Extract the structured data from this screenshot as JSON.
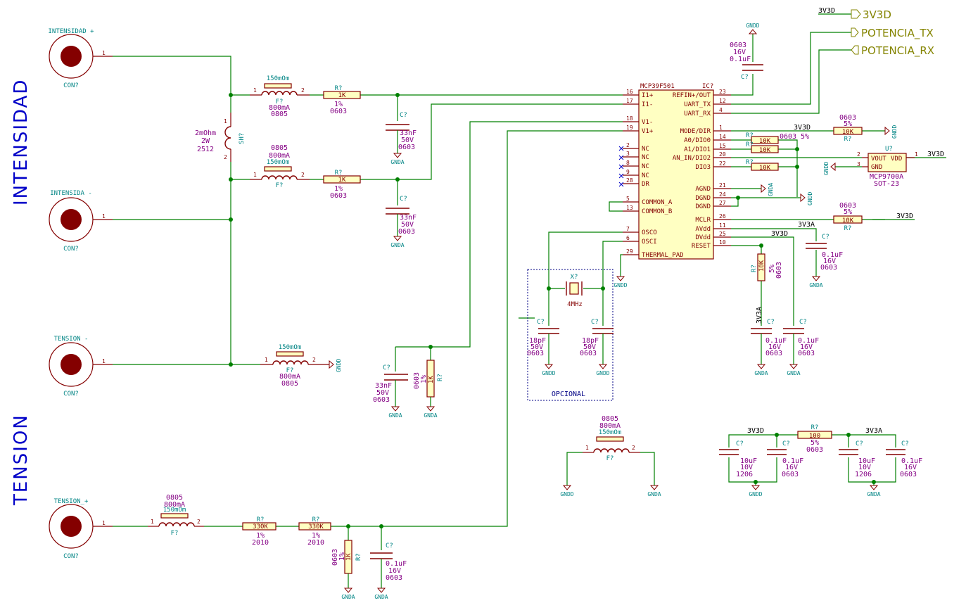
{
  "sections": {
    "intensidad": "INTENSIDAD",
    "tension": "TENSION"
  },
  "global_labels": {
    "v3v3d": "3V3D",
    "tx": "POTENCIA_TX",
    "rx": "POTENCIA_RX"
  },
  "connectors": [
    {
      "title": "INTENSIDAD +",
      "ref": "CON?",
      "pin": "1"
    },
    {
      "title": "INTENSIDA -",
      "ref": "CON?",
      "pin": "1"
    },
    {
      "title": "TENSION -",
      "ref": "CON?",
      "pin": "1"
    },
    {
      "title": "TENSION_+",
      "ref": "CON?",
      "pin": "1"
    }
  ],
  "ferrite": {
    "ref": "F?",
    "label": "150mOm",
    "current": "800mA",
    "package": "0805"
  },
  "shunt": {
    "ref": "SH?",
    "value": "2mOhm",
    "power": "2W",
    "package": "2512"
  },
  "ic": {
    "ref": "IC?",
    "name": "MCP39F501",
    "left_pins": [
      {
        "num": "16",
        "name": "I1+"
      },
      {
        "num": "17",
        "name": "I1-"
      },
      {
        "num": "18",
        "name": "V1-"
      },
      {
        "num": "19",
        "name": "V1+"
      },
      {
        "num": "2",
        "name": "NC"
      },
      {
        "num": "3",
        "name": "NC"
      },
      {
        "num": "8",
        "name": "NC"
      },
      {
        "num": "9",
        "name": "NC"
      },
      {
        "num": "28",
        "name": "DR"
      },
      {
        "num": "5",
        "name": "COMMON_A"
      },
      {
        "num": "13",
        "name": "COMMON_B"
      },
      {
        "num": "7",
        "name": "OSCO"
      },
      {
        "num": "6",
        "name": "OSCI"
      },
      {
        "num": "29",
        "name": "THERMAL_PAD"
      }
    ],
    "right_pins": [
      {
        "num": "23",
        "name": "REFIN+/OUT"
      },
      {
        "num": "12",
        "name": "UART_TX"
      },
      {
        "num": "4",
        "name": "UART_RX"
      },
      {
        "num": "1",
        "name": "MODE/DIR"
      },
      {
        "num": "14",
        "name": "A0/DIO0"
      },
      {
        "num": "15",
        "name": "A1/DIO1"
      },
      {
        "num": "20",
        "name": "AN_IN/DIO2"
      },
      {
        "num": "22",
        "name": "DIO3"
      },
      {
        "num": "21",
        "name": "AGND"
      },
      {
        "num": "24",
        "name": "DGND"
      },
      {
        "num": "27",
        "name": "DGND"
      },
      {
        "num": "26",
        "name": "MCLR"
      },
      {
        "num": "11",
        "name": "AVdd"
      },
      {
        "num": "25",
        "name": "DVdd"
      },
      {
        "num": "10",
        "name": "RESET"
      }
    ]
  },
  "temp_sensor": {
    "ref": "U?",
    "name": "MCP9700A",
    "package": "SOT-23",
    "pins": [
      "VOUT",
      "VDD",
      "GND"
    ],
    "pin_numbers": [
      "2",
      "1",
      "3"
    ]
  },
  "crystal": {
    "ref": "X?",
    "value": "4MHz"
  },
  "opcional": "OPCIONAL",
  "resistors": {
    "r_1k_top": {
      "ref": "R?",
      "value": "1K",
      "tol": "1%",
      "pkg": "0603"
    },
    "r_1k_bot": {
      "ref": "R?",
      "value": "1K",
      "tol": "1%",
      "pkg": "0603"
    },
    "r_v_div": {
      "ref": "R?",
      "value": "1K",
      "tol": "1%",
      "pkg": "0603"
    },
    "r_mode": {
      "ref": "R?",
      "value": "10K",
      "tol": "5%",
      "pkg": "0603"
    },
    "r_a0": {
      "ref": "R?",
      "value": "10K",
      "tol": "5%",
      "pkg": "0603"
    },
    "r_a1": {
      "ref": "R?",
      "value": "10K"
    },
    "r_dio3": {
      "ref": "R?",
      "value": "10K"
    },
    "r_mclr": {
      "ref": "R?",
      "value": "10K",
      "tol": "5%",
      "pkg": "0603"
    },
    "r_reset": {
      "ref": "R?",
      "value": "10K",
      "tol": "5%",
      "pkg": "0603"
    },
    "r_330a": {
      "ref": "R?",
      "value": "330K",
      "tol": "1%",
      "pkg": "2010"
    },
    "r_330b": {
      "ref": "R?",
      "value": "330K",
      "tol": "1%",
      "pkg": "2010"
    },
    "r_tension": {
      "ref": "R?",
      "value": "1K",
      "tol": "1%",
      "pkg": "0603"
    },
    "r_100": {
      "ref": "R?",
      "value": "100",
      "tol": "5%",
      "pkg": "0603"
    }
  },
  "capacitors": {
    "c33_a": {
      "ref": "C?",
      "value": "33nF",
      "volt": "50V",
      "pkg": "0603"
    },
    "c33_b": {
      "ref": "C?",
      "value": "33nF",
      "volt": "50V",
      "pkg": "0603"
    },
    "c33_c": {
      "ref": "C?",
      "value": "33nF",
      "volt": "50V",
      "pkg": "0603"
    },
    "c_ref": {
      "ref": "C?",
      "value": "0.1uF",
      "volt": "16V",
      "pkg": "0603"
    },
    "c18_a": {
      "ref": "C?",
      "value": "18pF",
      "volt": "50V",
      "pkg": "0603"
    },
    "c18_b": {
      "ref": "C?",
      "value": "18pF",
      "volt": "50V",
      "pkg": "0603"
    },
    "c_avdd": {
      "ref": "C?",
      "value": "0.1uF",
      "volt": "16V",
      "pkg": "0603"
    },
    "c_3v3a_a": {
      "ref": "C?",
      "value": "0.1uF",
      "volt": "16V",
      "pkg": "0603"
    },
    "c_3v3a_b": {
      "ref": "C?",
      "value": "0.1uF",
      "volt": "16V",
      "pkg": "0603"
    },
    "c_vplus": {
      "ref": "C?",
      "value": "0.1uF",
      "volt": "16V",
      "pkg": "0603"
    },
    "c10_d": {
      "ref": "C?",
      "value": "10uF",
      "volt": "10V",
      "pkg": "1206"
    },
    "c01_d": {
      "ref": "C?",
      "value": "0.1uF",
      "volt": "16V",
      "pkg": "0603"
    },
    "c10_a": {
      "ref": "C?",
      "value": "10uF",
      "volt": "10V",
      "pkg": "1206"
    },
    "c01_a": {
      "ref": "C?",
      "value": "0.1uF",
      "volt": "16V",
      "pkg": "0603"
    }
  },
  "nets": {
    "gnda": "GNDA",
    "gndd": "GNDD",
    "v3v3d": "3V3D",
    "v3v3a": "3V3A"
  }
}
